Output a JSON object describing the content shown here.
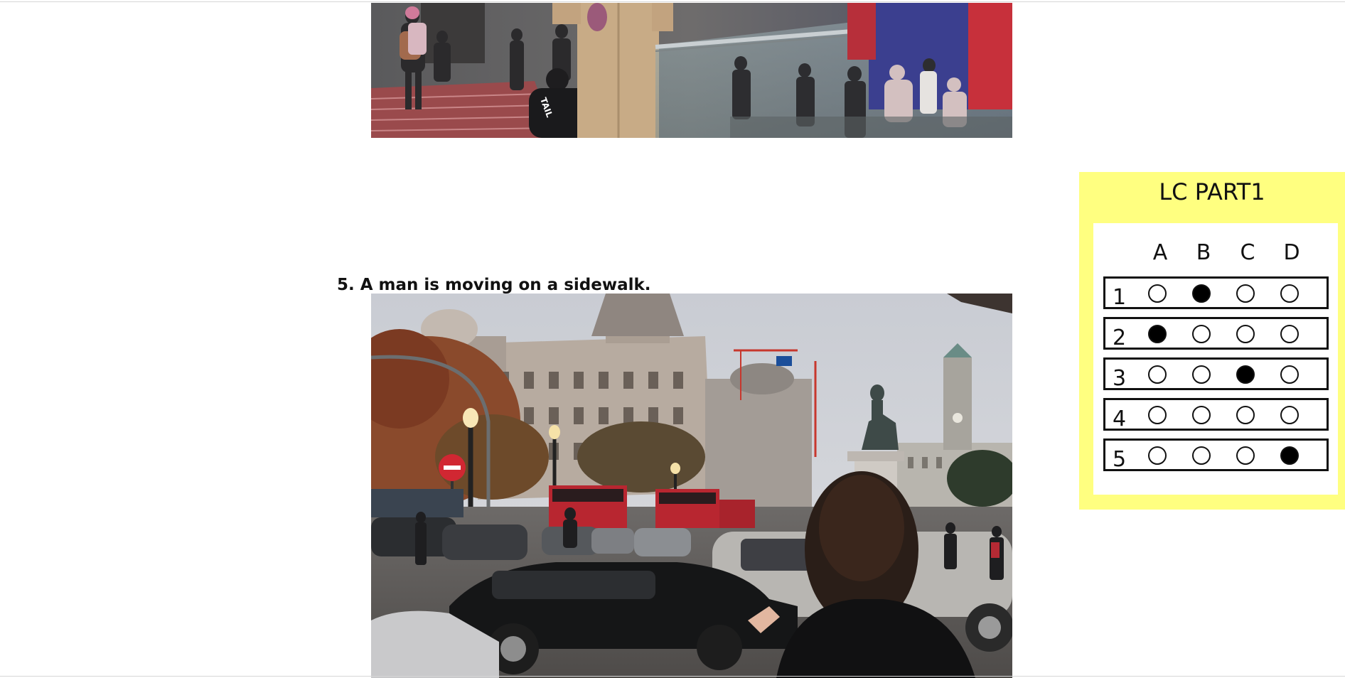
{
  "question": {
    "text": "5. A man is moving on a sidewalk."
  },
  "photos": [
    {
      "subject": "street-stairs-photo"
    },
    {
      "subject": "city-square-traffic-photo"
    }
  ],
  "answer_sheet": {
    "title": "LC PART1",
    "columns": [
      "A",
      "B",
      "C",
      "D"
    ],
    "rows": [
      {
        "number": "1",
        "selected": "B"
      },
      {
        "number": "2",
        "selected": "A"
      },
      {
        "number": "3",
        "selected": "C"
      },
      {
        "number": "4",
        "selected": ""
      },
      {
        "number": "5",
        "selected": "D"
      }
    ],
    "panel_color": "#ffff80",
    "mark_color": "#000000"
  }
}
